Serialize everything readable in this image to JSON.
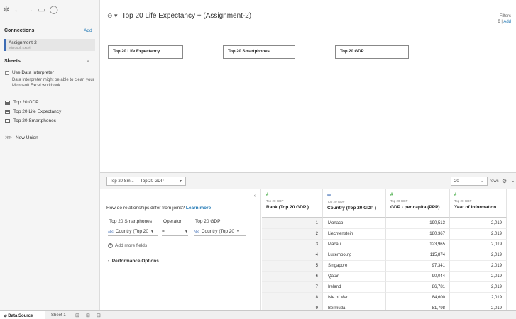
{
  "toolbar": {
    "logo_icon": "tableau-logo-icon",
    "back_icon": "arrow-left-icon",
    "forward_icon": "arrow-right-icon",
    "save_icon": "save-icon",
    "refresh_icon": "refresh-icon"
  },
  "sidebar": {
    "connections_title": "Connections",
    "connections_add": "Add",
    "connection": {
      "name": "Assignment-2",
      "type": "Microsoft Excel"
    },
    "sheets_title": "Sheets",
    "use_interpreter_label": "Use Data Interpreter",
    "interpreter_desc": "Data Interpreter might be able to clean your Microsoft Excel workbook.",
    "sheets": [
      "Top 20 GDP",
      "Top 20 Life Expectancy",
      "Top 20 Smartphones"
    ],
    "new_union": "New Union"
  },
  "canvas": {
    "title": "Top 20 Life Expectancy  + (Assignment-2)",
    "filters_label": "Filters",
    "filters_count": "0",
    "filters_sep": "|",
    "filters_add": "Add",
    "nodes": [
      "Top 20 Life Expectancy",
      "Top 20 Smartphones",
      "Top 20 GDP"
    ],
    "colors": {
      "connector_gray": "#9e9e9e",
      "connector_orange": "#f5a34a"
    }
  },
  "lower_bar": {
    "relationship_select": "Top 20 Sm...  — Top 20 GDP",
    "rows_value": "20",
    "rows_arrow": "→",
    "rows_label": "rows"
  },
  "join_panel": {
    "question": "How do relationships differ from joins?",
    "learn_more": "Learn more",
    "left_table": "Top 20 Smartphones",
    "operator_label": "Operator",
    "right_table": "Top 20 GDP",
    "left_field": "Country (Top 20",
    "operator_value": "=",
    "right_field": "Country (Top 20",
    "abc_tag": "Abc",
    "add_more_fields": "Add more fields",
    "performance_options": "Performance Options"
  },
  "grid": {
    "columns": [
      {
        "type_icon": "#",
        "source": "Top 20 GDP",
        "name": "Rank (Top 20 GDP )"
      },
      {
        "type_icon": "⊕",
        "source": "Top 20 GDP",
        "name": "Country (Top 20 GDP )"
      },
      {
        "type_icon": "#",
        "source": "Top 20 GDP",
        "name": "GDP - per capita (PPP)"
      },
      {
        "type_icon": "#",
        "source": "Top 20 GDP",
        "name": "Year of Information"
      }
    ],
    "rows": [
      [
        "1",
        "Monaco",
        "190,513",
        "2,019"
      ],
      [
        "2",
        "Liechtenstein",
        "180,367",
        "2,019"
      ],
      [
        "3",
        "Macau",
        "123,965",
        "2,019"
      ],
      [
        "4",
        "Luxembourg",
        "115,874",
        "2,019"
      ],
      [
        "5",
        "Singapore",
        "97,341",
        "2,019"
      ],
      [
        "6",
        "Qatar",
        "90,044",
        "2,019"
      ],
      [
        "7",
        "Ireland",
        "86,781",
        "2,019"
      ],
      [
        "8",
        "Isle of Man",
        "84,600",
        "2,019"
      ],
      [
        "9",
        "Bermuda",
        "81,798",
        "2,019"
      ]
    ]
  },
  "bottom_tabs": {
    "data_source": "Data Source",
    "sheet1": "Sheet 1"
  }
}
